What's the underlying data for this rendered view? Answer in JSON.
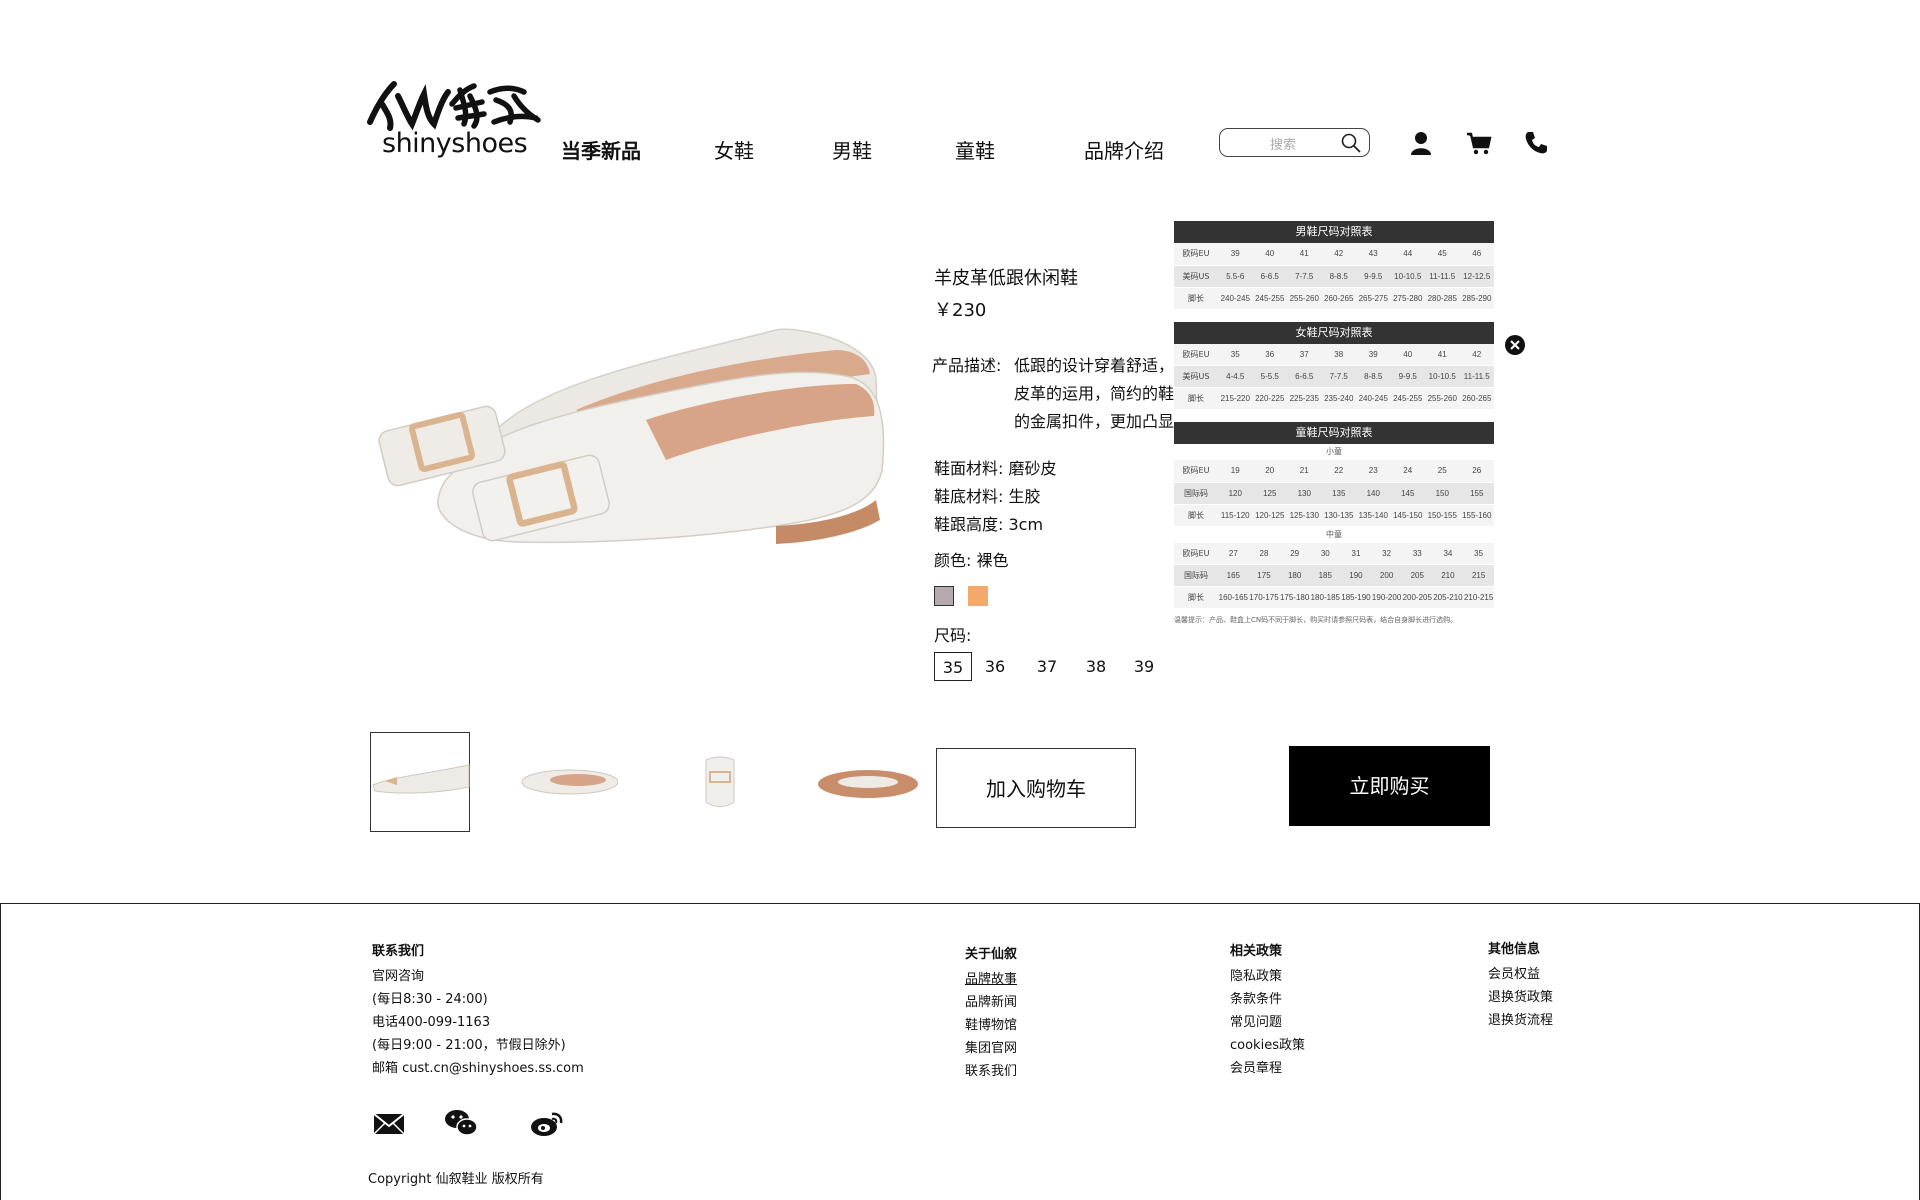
{
  "header": {
    "logo_text": "shinyshoes",
    "nav": [
      "当季新品",
      "女鞋",
      "男鞋",
      "童鞋",
      "品牌介绍"
    ],
    "search_placeholder": "搜索",
    "icons": [
      "search-icon",
      "user-icon",
      "cart-icon",
      "phone-icon"
    ]
  },
  "product": {
    "name": "羊皮革低跟休闲鞋",
    "price": "￥230",
    "desc_label": "产品描述:",
    "desc_lines": [
      "低跟的设计穿着舒适，",
      "皮革的运用，简约的鞋",
      "的金属扣件，更加凸显"
    ],
    "upper_material": "鞋面材料: 磨砂皮",
    "sole_material": "鞋底材料: 生胶",
    "heel_height": "鞋跟高度: 3cm",
    "color_label": "颜色:  裸色",
    "swatches": [
      "#b7a9b0",
      "#f2a96a"
    ],
    "size_label": "尺码:",
    "sizes": [
      "35",
      "36",
      "37",
      "38",
      "39"
    ],
    "selected_size": "35",
    "add_to_cart": "加入购物车",
    "buy_now": "立即购买"
  },
  "size_chart": {
    "men": {
      "title": "男鞋尺码对照表",
      "rows": [
        {
          "label": "欧码EU",
          "values": [
            "39",
            "40",
            "41",
            "42",
            "43",
            "44",
            "45",
            "46"
          ]
        },
        {
          "label": "美码US",
          "values": [
            "5.5-6",
            "6-6.5",
            "7-7.5",
            "8-8.5",
            "9-9.5",
            "10-10.5",
            "11-11.5",
            "12-12.5"
          ]
        },
        {
          "label": "脚长",
          "values": [
            "240-245",
            "245-255",
            "255-260",
            "260-265",
            "265-275",
            "275-280",
            "280-285",
            "285-290"
          ]
        }
      ]
    },
    "women": {
      "title": "女鞋尺码对照表",
      "rows": [
        {
          "label": "欧码EU",
          "values": [
            "35",
            "36",
            "37",
            "38",
            "39",
            "40",
            "41",
            "42"
          ]
        },
        {
          "label": "美码US",
          "values": [
            "4-4.5",
            "5-5.5",
            "6-6.5",
            "7-7.5",
            "8-8.5",
            "9-9.5",
            "10-10.5",
            "11-11.5"
          ]
        },
        {
          "label": "脚长",
          "values": [
            "215-220",
            "220-225",
            "225-235",
            "235-240",
            "240-245",
            "245-255",
            "255-260",
            "260-265"
          ]
        }
      ]
    },
    "kids": {
      "title": "童鞋尺码对照表",
      "small_label": "小童",
      "small_rows": [
        {
          "label": "欧码EU",
          "values": [
            "19",
            "20",
            "21",
            "22",
            "23",
            "24",
            "25",
            "26"
          ]
        },
        {
          "label": "国际码",
          "values": [
            "120",
            "125",
            "130",
            "135",
            "140",
            "145",
            "150",
            "155"
          ]
        },
        {
          "label": "脚长",
          "values": [
            "115-120",
            "120-125",
            "125-130",
            "130-135",
            "135-140",
            "145-150",
            "150-155",
            "155-160"
          ]
        }
      ],
      "mid_label": "中童",
      "mid_rows": [
        {
          "label": "欧码EU",
          "values": [
            "27",
            "28",
            "29",
            "30",
            "31",
            "32",
            "33",
            "34",
            "35"
          ]
        },
        {
          "label": "国际码",
          "values": [
            "165",
            "175",
            "180",
            "185",
            "190",
            "200",
            "205",
            "210",
            "215"
          ]
        },
        {
          "label": "脚长",
          "values": [
            "160-165",
            "170-175",
            "175-180",
            "180-185",
            "185-190",
            "190-200",
            "200-205",
            "205-210",
            "210-215"
          ]
        }
      ]
    },
    "note": "温馨提示：产品、鞋盒上CN码不同于脚长，购买时请参照尺码表，结合自身脚长进行选购。"
  },
  "footer": {
    "contact": {
      "title": "联系我们",
      "lines": [
        "官网咨询",
        "(每日8:30 - 24:00)",
        "电话400-099-1163",
        "(每日9:00 - 21:00，节假日除外)",
        "邮箱 cust.cn@shinyshoes.ss.com"
      ]
    },
    "about": {
      "title": "关于仙叙",
      "links": [
        "品牌故事",
        "品牌新闻",
        "鞋博物馆",
        "集团官网",
        "联系我们"
      ]
    },
    "policy": {
      "title": "相关政策",
      "links": [
        "隐私政策",
        "条款条件",
        "常见问题",
        "cookies政策",
        "会员章程"
      ]
    },
    "other": {
      "title": "其他信息",
      "links": [
        "会员权益",
        "退换货政策",
        "退换货流程"
      ]
    },
    "social": [
      "mail-icon",
      "wechat-icon",
      "weibo-icon"
    ],
    "copyright": "Copyright 仙叙鞋业 版权所有"
  }
}
